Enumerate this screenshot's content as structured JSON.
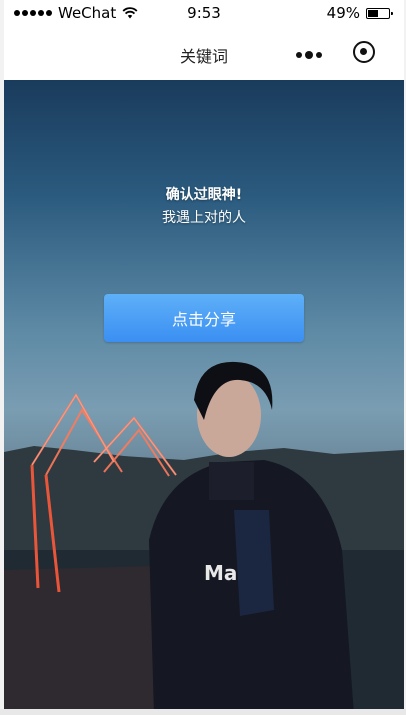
{
  "status_bar": {
    "carrier": "WeChat",
    "time": "9:53",
    "battery": "49%",
    "battery_level": 0.49,
    "icons": [
      "signal-icon",
      "wifi-icon",
      "battery-icon"
    ]
  },
  "nav": {
    "title": "关键词",
    "icons": [
      "more-icon",
      "close-icon"
    ]
  },
  "content": {
    "message_line1": "确认过眼神!",
    "message_line2": "我遇上对的人",
    "share_button_label": "点击分享",
    "background": "photo-person-neon-mountains",
    "colors": {
      "button": "#4a9ff5",
      "sky_top": "#1a3b5c",
      "neon": "#ff6a4d"
    }
  }
}
